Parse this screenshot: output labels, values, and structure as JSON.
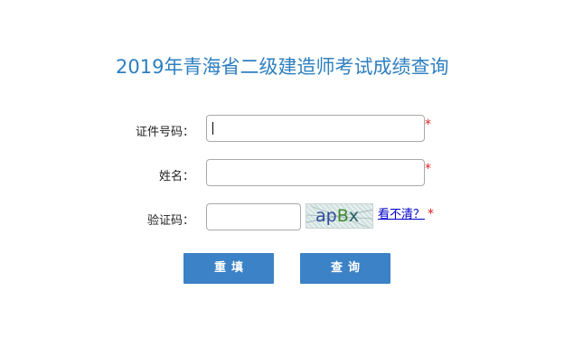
{
  "page": {
    "title": "2019年青海省二级建造师考试成绩查询"
  },
  "form": {
    "id_label": "证件号码：",
    "name_label": "姓名：",
    "captcha_label": "验证码：",
    "id_value": "",
    "name_value": "",
    "captcha_value": "",
    "required_mark": "*",
    "captcha_text": "apBx",
    "refresh_link": "看不清？"
  },
  "buttons": {
    "reset": "重填",
    "query": "查询"
  },
  "colors": {
    "title": "#2e7fc0",
    "button_bg": "#3c82c6",
    "required": "#e02020",
    "link": "#0000cc"
  }
}
